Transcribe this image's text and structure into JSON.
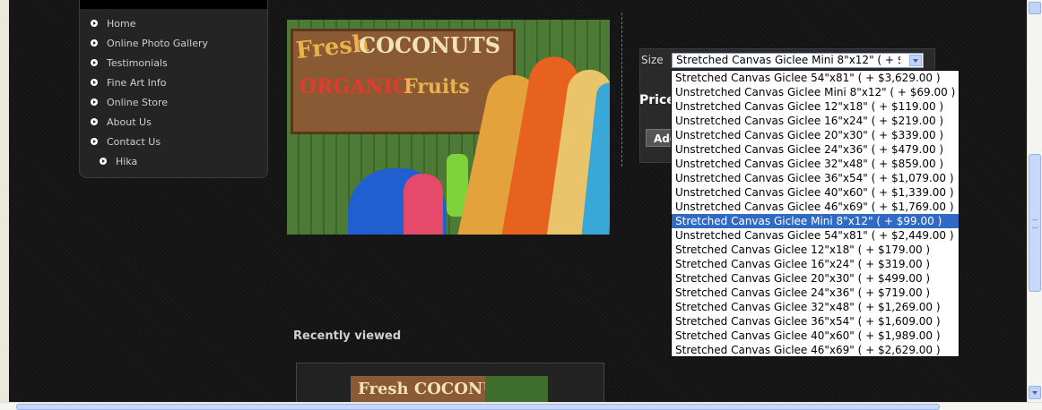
{
  "nav": {
    "items": [
      {
        "label": "Home"
      },
      {
        "label": "Online Photo Gallery"
      },
      {
        "label": "Testimonials"
      },
      {
        "label": "Fine Art Info"
      },
      {
        "label": "Online Store"
      },
      {
        "label": "About Us"
      },
      {
        "label": "Contact Us"
      }
    ],
    "subitem": {
      "label": "Hika"
    }
  },
  "photo": {
    "sign_word1": "Fresh",
    "sign_word2": "COCONUTS",
    "sign_word3": "ORGANIC",
    "sign_word4": "Fruits"
  },
  "product": {
    "size_label": "Size",
    "selected_size": "Stretched Canvas Giclee Mini 8\"x12\" ( + $99.00 )",
    "price_label": "Price",
    "add_button_label": "Add",
    "size_options": [
      "Stretched Canvas Giclee 54\"x81\" ( + $3,629.00 )",
      "Unstretched Canvas Giclee Mini 8\"x12\" ( + $69.00 )",
      "Unstretched Canvas Giclee 12\"x18\" ( + $119.00 )",
      "Unstretched Canvas Giclee 16\"x24\" ( + $219.00 )",
      "Unstretched Canvas Giclee 20\"x30\" ( + $339.00 )",
      "Unstretched Canvas Giclee 24\"x36\" ( + $479.00 )",
      "Unstretched Canvas Giclee 32\"x48\" ( + $859.00 )",
      "Unstretched Canvas Giclee 36\"x54\" ( + $1,079.00 )",
      "Unstretched Canvas Giclee 40\"x60\" ( + $1,339.00 )",
      "Unstretched Canvas Giclee 46\"x69\" ( + $1,769.00 )",
      "Stretched Canvas Giclee Mini 8\"x12\" ( + $99.00 )",
      "Unstretched Canvas Giclee 54\"x81\" ( + $2,449.00 )",
      "Stretched Canvas Giclee 12\"x18\" ( + $179.00 )",
      "Stretched Canvas Giclee 16\"x24\" ( + $319.00 )",
      "Stretched Canvas Giclee 20\"x30\" ( + $499.00 )",
      "Stretched Canvas Giclee 24\"x36\" ( + $719.00 )",
      "Stretched Canvas Giclee 32\"x48\" ( + $1,269.00 )",
      "Stretched Canvas Giclee 36\"x54\" ( + $1,609.00 )",
      "Stretched Canvas Giclee 40\"x60\" ( + $1,989.00 )",
      "Stretched Canvas Giclee 46\"x69\" ( + $2,629.00 )"
    ],
    "highlighted_index": 10
  },
  "recent": {
    "title": "Recently viewed",
    "thumb_text": "Fresh COCONUTS"
  },
  "colors": {
    "page_bg": "#141414",
    "selection": "#316ac5",
    "scroll_thumb": "#c8d7fb"
  }
}
